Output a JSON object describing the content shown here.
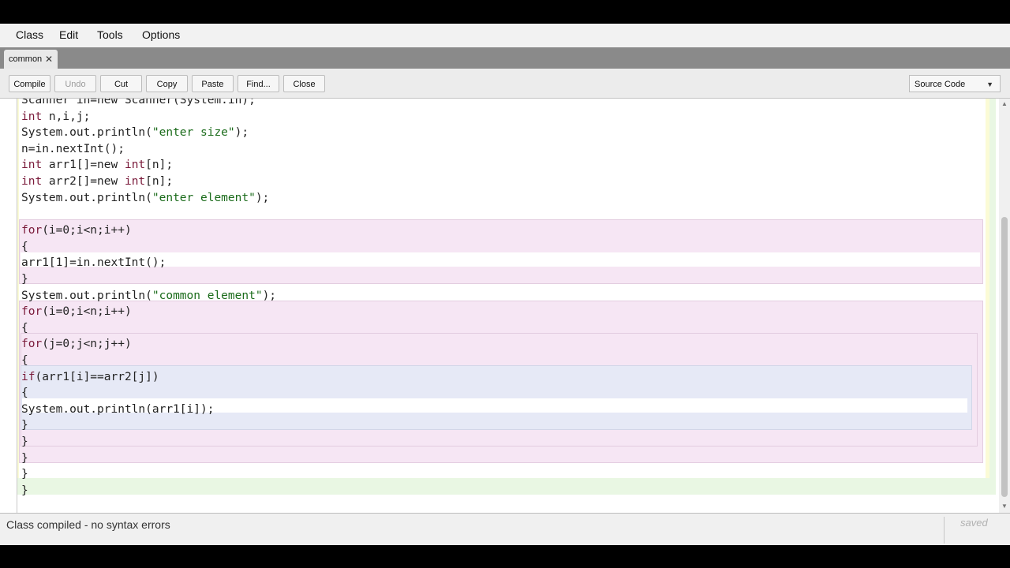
{
  "menu": [
    "Class",
    "Edit",
    "Tools",
    "Options"
  ],
  "tab": {
    "label": "common",
    "close": "✕"
  },
  "toolbar": {
    "compile": "Compile",
    "undo": "Undo",
    "cut": "Cut",
    "copy": "Copy",
    "paste": "Paste",
    "find": "Find...",
    "close": "Close",
    "view_select": "Source Code",
    "view_arrow": "▼"
  },
  "code": {
    "l0_a": "Scanner in=new Scanner(System.in);",
    "l1_kw": "int",
    "l1_rest": " n,i,j;",
    "l2_a": "System.out.println(",
    "l2_str": "\"enter size\"",
    "l2_b": ");",
    "l3": "n=in.nextInt();",
    "l4_kw": "int",
    "l4_a": " arr1[]=new ",
    "l4_kw2": "int",
    "l4_b": "[n];",
    "l5_kw": "int",
    "l5_a": " arr2[]=new ",
    "l5_kw2": "int",
    "l5_b": "[n];",
    "l6_a": "System.out.println(",
    "l6_str": "\"enter element\"",
    "l6_b": ");",
    "l8_kw": "for",
    "l8_rest": "(i=0;i<n;i++)",
    "l9": "{",
    "l10": "arr1[1]=in.nextInt();",
    "l11": "}",
    "l12_a": "System.out.println(",
    "l12_str": "\"common element\"",
    "l12_b": ");",
    "l13_kw": "for",
    "l13_rest": "(i=0;i<n;i++)",
    "l14": "{",
    "l15_kw": "for",
    "l15_rest": "(j=0;j<n;j++)",
    "l16": "{",
    "l17_kw": "if",
    "l17_rest": "(arr1[i]==arr2[j])",
    "l18": "{",
    "l19": "System.out.println(arr1[i]);",
    "l20": "}",
    "l21": "}",
    "l22": "}",
    "l23": "}",
    "l24": "}"
  },
  "status": {
    "message": "Class compiled - no syntax errors",
    "saved": "saved"
  },
  "colors": {
    "class_scope": "#e9f7e3",
    "method_scope": "#fbfbd6",
    "loop_scope": "#f6e6f4",
    "if_scope": "#e6e9f6",
    "keyword": "#7a1a3a",
    "string": "#1a6b1a"
  }
}
